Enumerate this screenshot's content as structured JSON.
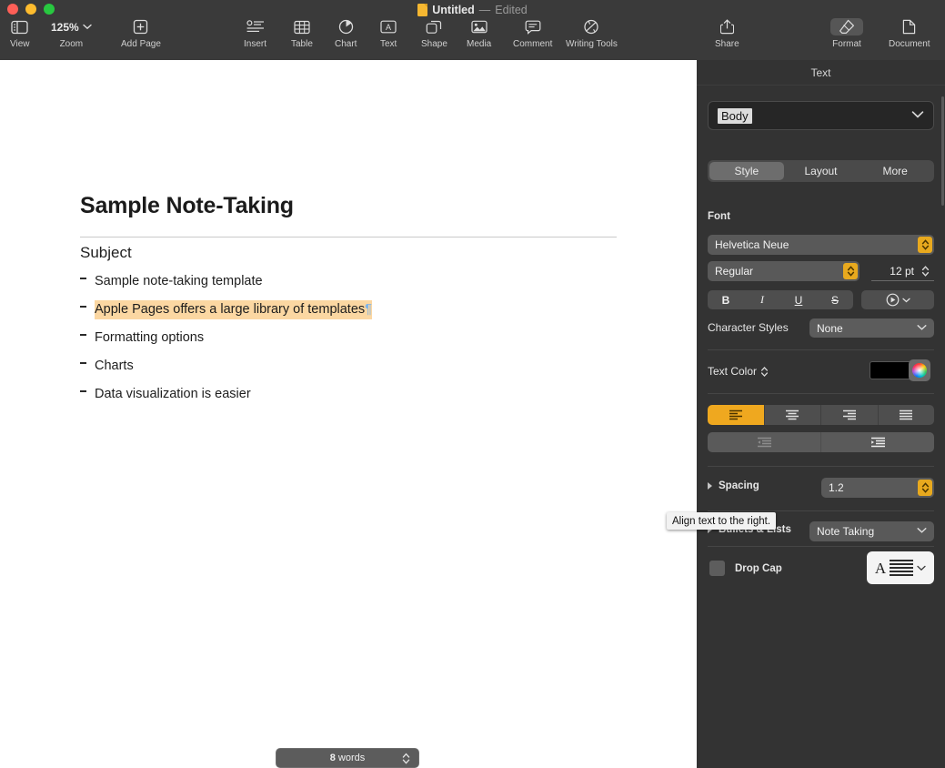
{
  "window": {
    "title": "Untitled",
    "dash": "—",
    "status": "Edited",
    "file_icon": "pages-document-icon"
  },
  "toolbar": {
    "left_items": [
      {
        "label": "View",
        "icon": "sidebar-icon"
      },
      {
        "label": "Zoom",
        "icon": "chevron-down-icon",
        "value": "125%"
      },
      {
        "label": "Add Page",
        "icon": "add-page-icon"
      }
    ],
    "center_items": [
      {
        "label": "Insert",
        "icon": "insert-icon"
      },
      {
        "label": "Table",
        "icon": "table-icon"
      },
      {
        "label": "Chart",
        "icon": "chart-icon"
      },
      {
        "label": "Text",
        "icon": "text-box-icon"
      },
      {
        "label": "Shape",
        "icon": "shape-icon"
      },
      {
        "label": "Media",
        "icon": "media-icon"
      },
      {
        "label": "Comment",
        "icon": "comment-icon"
      },
      {
        "label": "Writing Tools",
        "icon": "writing-tools-icon"
      }
    ],
    "right_items": [
      {
        "label": "Share",
        "icon": "share-icon",
        "active": false
      },
      {
        "label": "Format",
        "icon": "format-brush-icon",
        "active": true
      },
      {
        "label": "Document",
        "icon": "document-icon",
        "active": false
      }
    ]
  },
  "document": {
    "title": "Sample Note-Taking",
    "subject_heading": "Subject",
    "bullets": [
      {
        "text": "Sample note-taking template",
        "highlighted": false,
        "pilcrow": false
      },
      {
        "text": "Apple Pages offers a large library of templates",
        "highlighted": true,
        "pilcrow": true
      },
      {
        "text": "Formatting options",
        "highlighted": false,
        "pilcrow": false
      },
      {
        "text": "Charts",
        "highlighted": false,
        "pilcrow": false
      },
      {
        "text": "Data visualization is easier",
        "highlighted": false,
        "pilcrow": false
      }
    ],
    "pilcrow_glyph": "¶",
    "word_count": "8 words",
    "word_count_number": "8",
    "word_count_unit": " words",
    "highlight_color": "#fbd7a2"
  },
  "panel": {
    "header": "Text",
    "paragraph_style": "Body",
    "tabs": [
      {
        "label": "Style",
        "selected": true
      },
      {
        "label": "Layout",
        "selected": false
      },
      {
        "label": "More",
        "selected": false
      }
    ],
    "font": {
      "section_label": "Font",
      "family": "Helvetica Neue",
      "weight": "Regular",
      "size": "12 pt"
    },
    "text_buttons": {
      "bold": "B",
      "italic": "I",
      "underline": "U",
      "strikethrough": "S",
      "more_icon": "more-text-options-icon"
    },
    "character_styles": {
      "label": "Character Styles",
      "value": "None"
    },
    "text_color": {
      "label": "Text Color",
      "swatch": "#000000",
      "wheel_icon": "color-wheel-icon"
    },
    "alignment": {
      "buttons": [
        {
          "name": "align-left",
          "selected": true
        },
        {
          "name": "align-center",
          "selected": false
        },
        {
          "name": "align-right",
          "selected": false
        },
        {
          "name": "align-justify",
          "selected": false
        }
      ],
      "indent_buttons": [
        {
          "name": "decrease-indent",
          "selected": false
        },
        {
          "name": "increase-indent",
          "selected": false
        }
      ],
      "accent_color": "#efa81f"
    },
    "spacing": {
      "label": "Spacing",
      "value": "1.2"
    },
    "bullets_lists": {
      "label": "Bullets & Lists",
      "value": "Note Taking"
    },
    "drop_cap": {
      "label": "Drop Cap",
      "checked": false,
      "preview_letter": "A"
    },
    "tooltip": "Align text to the right."
  }
}
